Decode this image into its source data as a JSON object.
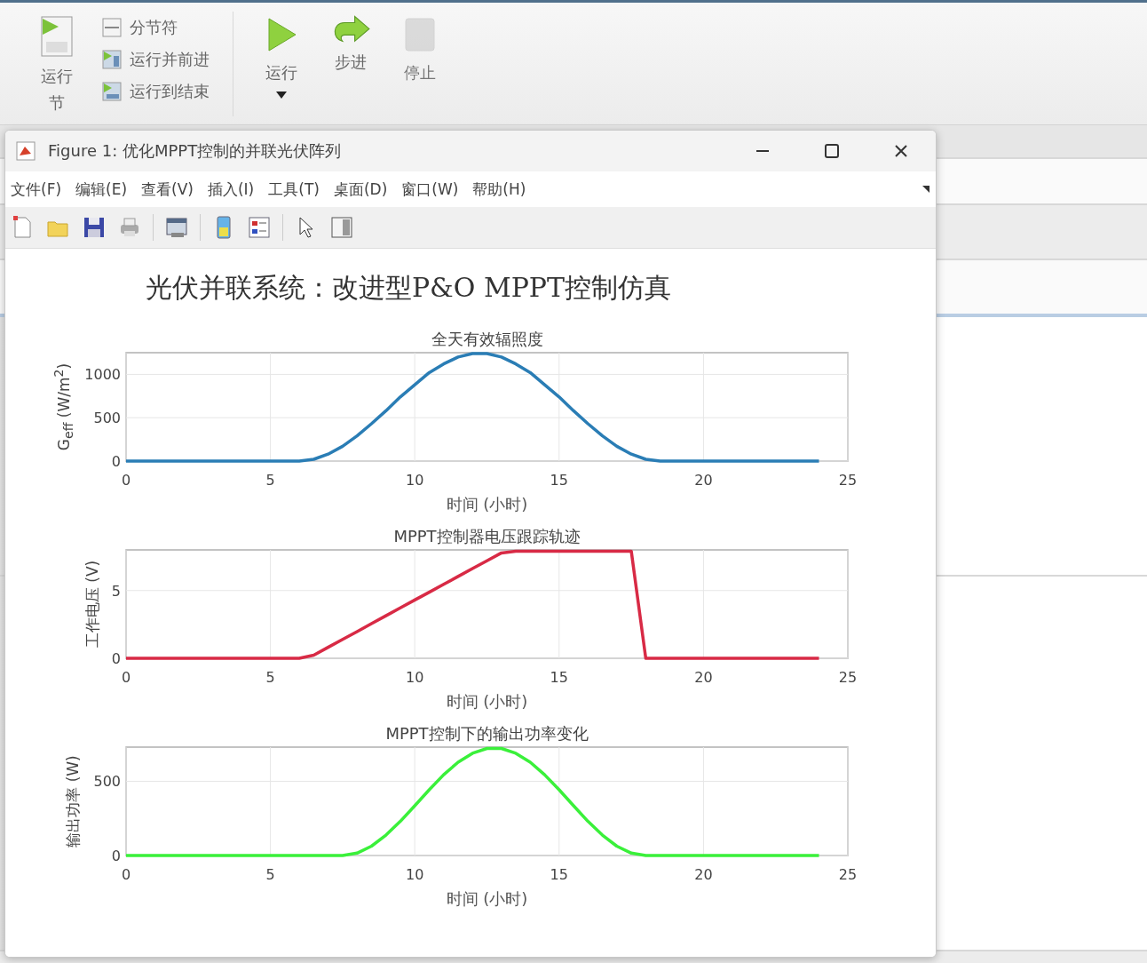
{
  "ribbon": {
    "section_run": {
      "label": "运行节"
    },
    "section_items": [
      {
        "label": "分节符",
        "kind": "section-break"
      },
      {
        "label": "运行并前进",
        "kind": "run-advance"
      },
      {
        "label": "运行到结束",
        "kind": "run-to-end"
      }
    ],
    "run_buttons": [
      {
        "label": "运行",
        "kind": "run",
        "dropdown": true,
        "disabled": false
      },
      {
        "label": "步进",
        "kind": "step",
        "dropdown": false,
        "disabled": false
      },
      {
        "label": "停止",
        "kind": "stop",
        "dropdown": false,
        "disabled": true
      }
    ]
  },
  "figure_window": {
    "title": "Figure 1: 优化MPPT控制的并联光伏阵列",
    "menu": [
      "文件(F)",
      "编辑(E)",
      "查看(V)",
      "插入(I)",
      "工具(T)",
      "桌面(D)",
      "窗口(W)",
      "帮助(H)"
    ],
    "suptitle": "光伏并联系统：改进型P&O MPPT控制仿真",
    "plots": [
      {
        "chart_data": {
          "type": "line",
          "title": "全天有效辐照度",
          "xlabel": "时间 (小时)",
          "ylabel": "G$_{eff}$ (W/m$^{2}$)",
          "xlim": [
            0,
            25
          ],
          "ylim": [
            0,
            1250
          ],
          "xticks": [
            0,
            5,
            10,
            15,
            20,
            25
          ],
          "yticks": [
            0,
            500,
            1000
          ],
          "grid": true,
          "x": [
            0,
            0.5,
            1,
            1.5,
            2,
            2.5,
            3,
            3.5,
            4,
            4.5,
            5,
            5.5,
            6,
            6.5,
            7,
            7.5,
            8,
            8.5,
            9,
            9.5,
            10,
            10.5,
            11,
            11.5,
            12,
            12.5,
            13,
            13.5,
            14,
            14.5,
            15,
            15.5,
            16,
            16.5,
            17,
            17.5,
            18,
            18.5,
            19,
            19.5,
            20,
            20.5,
            21,
            21.5,
            22,
            22.5,
            23,
            23.5,
            24
          ],
          "series": [
            {
              "color": "#2a7db5",
              "values": [
                0,
                0,
                0,
                0,
                0,
                0,
                0,
                0,
                0,
                0,
                0,
                0,
                0,
                20,
                80,
                170,
                290,
                430,
                580,
                740,
                880,
                1020,
                1120,
                1200,
                1240,
                1240,
                1200,
                1120,
                1020,
                880,
                740,
                580,
                430,
                290,
                170,
                80,
                20,
                0,
                0,
                0,
                0,
                0,
                0,
                0,
                0,
                0,
                0,
                0,
                0
              ]
            }
          ]
        }
      },
      {
        "chart_data": {
          "type": "line",
          "title": "MPPT控制器电压跟踪轨迹",
          "xlabel": "时间 (小时)",
          "ylabel": "工作电压 (V)",
          "xlim": [
            0,
            25
          ],
          "ylim": [
            0,
            8
          ],
          "xticks": [
            0,
            5,
            10,
            15,
            20,
            25
          ],
          "yticks": [
            0,
            5
          ],
          "grid": true,
          "x": [
            0,
            0.5,
            1,
            1.5,
            2,
            2.5,
            3,
            3.5,
            4,
            4.5,
            5,
            5.5,
            6,
            6.5,
            7,
            7.5,
            8,
            8.5,
            9,
            9.5,
            10,
            10.5,
            11,
            11.5,
            12,
            12.5,
            13,
            13.5,
            14,
            14.5,
            15,
            15.5,
            16,
            16.5,
            17,
            17.5,
            18,
            18.5,
            19,
            19.5,
            20,
            20.5,
            21,
            21.5,
            22,
            22.5,
            23,
            23.5,
            24
          ],
          "series": [
            {
              "color": "#d82a45",
              "values": [
                0,
                0,
                0,
                0,
                0,
                0,
                0,
                0,
                0,
                0,
                0,
                0,
                0,
                0.23,
                0.81,
                1.39,
                1.97,
                2.56,
                3.14,
                3.72,
                4.3,
                4.88,
                5.46,
                6.04,
                6.62,
                7.2,
                7.78,
                7.9,
                7.9,
                7.9,
                7.9,
                7.9,
                7.9,
                7.9,
                7.9,
                7.9,
                0,
                0,
                0,
                0,
                0,
                0,
                0,
                0,
                0,
                0,
                0,
                0,
                0
              ]
            }
          ]
        }
      },
      {
        "chart_data": {
          "type": "line",
          "title": "MPPT控制下的输出功率变化",
          "xlabel": "时间 (小时)",
          "ylabel": "输出功率 (W)",
          "xlim": [
            0,
            25
          ],
          "ylim": [
            0,
            730
          ],
          "xticks": [
            0,
            5,
            10,
            15,
            20,
            25
          ],
          "yticks": [
            0,
            500
          ],
          "grid": true,
          "x": [
            0,
            0.5,
            1,
            1.5,
            2,
            2.5,
            3,
            3.5,
            4,
            4.5,
            5,
            5.5,
            6,
            6.5,
            7,
            7.5,
            8,
            8.5,
            9,
            9.5,
            10,
            10.5,
            11,
            11.5,
            12,
            12.5,
            13,
            13.5,
            14,
            14.5,
            15,
            15.5,
            16,
            16.5,
            17,
            17.5,
            18,
            18.5,
            19,
            19.5,
            20,
            20.5,
            21,
            21.5,
            22,
            22.5,
            23,
            23.5,
            24
          ],
          "series": [
            {
              "color": "#3af03a",
              "values": [
                0,
                0,
                0,
                0,
                0,
                0,
                0,
                0,
                0,
                0,
                0,
                0,
                0,
                0,
                0,
                0,
                16,
                63,
                137,
                230,
                335,
                443,
                544,
                628,
                689,
                721,
                721,
                689,
                628,
                544,
                443,
                335,
                230,
                137,
                63,
                16,
                0,
                0,
                0,
                0,
                0,
                0,
                0,
                0,
                0,
                0,
                0,
                0,
                0
              ]
            }
          ]
        }
      }
    ]
  }
}
